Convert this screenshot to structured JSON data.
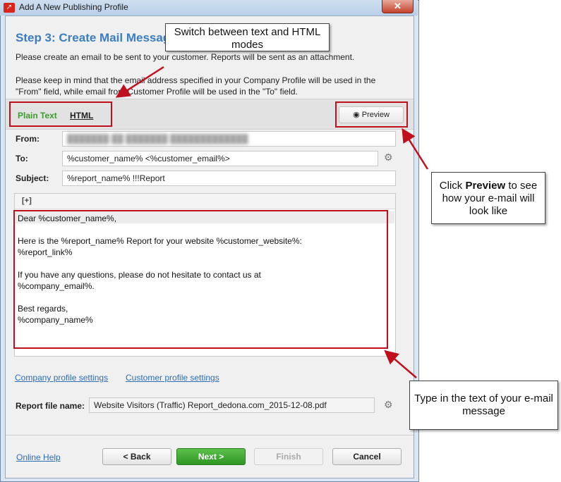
{
  "window": {
    "title": "Add A New Publishing Profile",
    "close_glyph": "✕"
  },
  "step": {
    "title": "Step 3: Create Mail Message",
    "intro": "Please create an email to be sent to your customer. Reports will be sent as an attachment.",
    "note": "Please keep in mind that the email address specified in your Company Profile will be used in the \"From\" field, while email from Customer Profile will be used in the \"To\" field."
  },
  "modes": {
    "plain_text": "Plain Text",
    "html": "HTML"
  },
  "preview": {
    "label": "Preview"
  },
  "form": {
    "from_label": "From:",
    "from_value": "███████ ██ ███████ █████████████",
    "to_label": "To:",
    "to_value": "%customer_name% <%customer_email%>",
    "subject_label": "Subject:",
    "subject_value": "%report_name% !!!Report"
  },
  "editor": {
    "expand_label": "[+]",
    "body": "Dear %customer_name%,\n\nHere is the %report_name% Report for your website %customer_website%:\n%report_link%\n\nIf you have any questions, please do not hesitate to contact us at\n%company_email%.\n\nBest regards,\n%company_name%"
  },
  "links": {
    "company": "Company profile settings",
    "customer": "Customer profile settings"
  },
  "report": {
    "label": "Report file name:",
    "value": "Website Visitors (Traffic) Report_dedona.com_2015-12-08.pdf"
  },
  "footer": {
    "help": "Online Help",
    "back": "< Back",
    "next": "Next >",
    "finish": "Finish",
    "cancel": "Cancel"
  },
  "annotations": {
    "modes": "Switch between text and HTML modes",
    "preview_pre": "Click ",
    "preview_bold": "Preview",
    "preview_post": " to see how your e-mail will look like",
    "body": "Type in the text of your e-mail message"
  },
  "colors": {
    "accent": "#3a7dc1",
    "plain_text_active": "#3d9b2e",
    "annotation_red": "#c0101e",
    "next_green": "#3aa52d"
  },
  "icons": {
    "preview": "eye-icon",
    "settings": "gear-icon",
    "app": "app-logo-icon"
  }
}
